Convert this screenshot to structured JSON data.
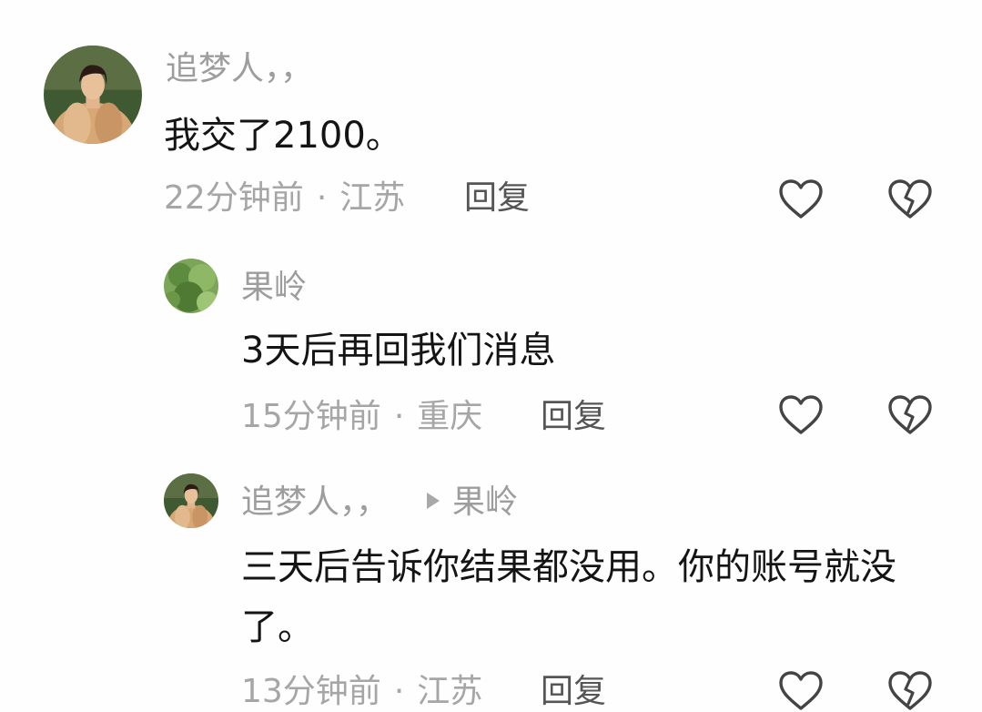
{
  "comments": [
    {
      "username": "追梦人，，",
      "text": "我交了2100。",
      "time": "22分钟前",
      "location": "江苏",
      "reply_label": "回复",
      "avatar": "man-in-fur-coat-avatar"
    },
    {
      "username": "果岭",
      "text": "3天后再回我们消息",
      "time": "15分钟前",
      "location": "重庆",
      "reply_label": "回复",
      "avatar": "green-plant-avatar"
    },
    {
      "username": "追梦人，，",
      "reply_to": "果岭",
      "text": "三天后告诉你结果都没用。你的账号就没了。",
      "time": "13分钟前",
      "location": "江苏",
      "reply_label": "回复",
      "avatar": "man-in-fur-coat-avatar"
    }
  ],
  "separator": "·",
  "icons": {
    "like": "heart-outline-icon",
    "dislike": "broken-heart-icon"
  },
  "colors": {
    "username": "#9d9d9d",
    "meta": "#a6a6a6",
    "text": "#141414",
    "reply": "#555555",
    "icon_stroke": "#444444"
  }
}
